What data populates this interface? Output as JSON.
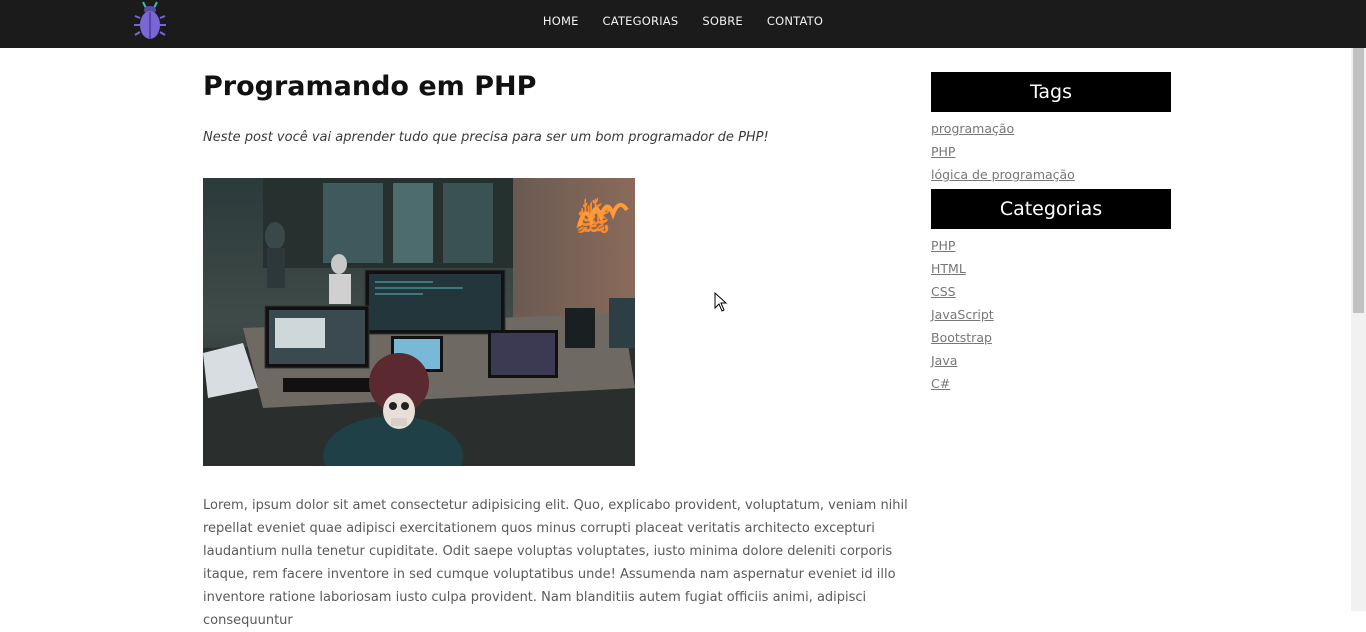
{
  "nav": {
    "items": [
      {
        "label": "HOME"
      },
      {
        "label": "CATEGORIAS"
      },
      {
        "label": "SOBRE"
      },
      {
        "label": "CONTATO"
      }
    ]
  },
  "logo": {
    "icon": "bug-icon",
    "color": "#7b66d6"
  },
  "post": {
    "title": "Programando em PHP",
    "subtitle": "Neste post você vai aprender tudo que precisa para ser um bom programador de PHP!",
    "body": "Lorem, ipsum dolor sit amet consectetur adipisicing elit. Quo, explicabo provident, voluptatum, veniam nihil repellat eveniet quae adipisci exercitationem quos minus corrupti placeat veritatis architecto excepturi laudantium nulla tenetur cupiditate. Odit saepe voluptas voluptates, iusto minima dolore deleniti corporis itaque, rem facere inventore in sed cumque voluptatibus unde! Assumenda nam aspernatur eveniet id illo inventore ratione laboriosam iusto culpa provident. Nam blanditiis autem fugiat officiis animi, adipisci consequuntur"
  },
  "sidebar": {
    "tags_title": "Tags",
    "tags": [
      {
        "label": "programação"
      },
      {
        "label": "PHP"
      },
      {
        "label": "lógica de programação"
      }
    ],
    "categories_title": "Categorias",
    "categories": [
      {
        "label": "PHP"
      },
      {
        "label": "HTML"
      },
      {
        "label": "CSS"
      },
      {
        "label": "JavaScript"
      },
      {
        "label": "Bootstrap"
      },
      {
        "label": "Java"
      },
      {
        "label": "C#"
      }
    ]
  },
  "colors": {
    "topbar": "#1b1b1b",
    "sidebar_header": "#000000",
    "link": "#777777"
  }
}
